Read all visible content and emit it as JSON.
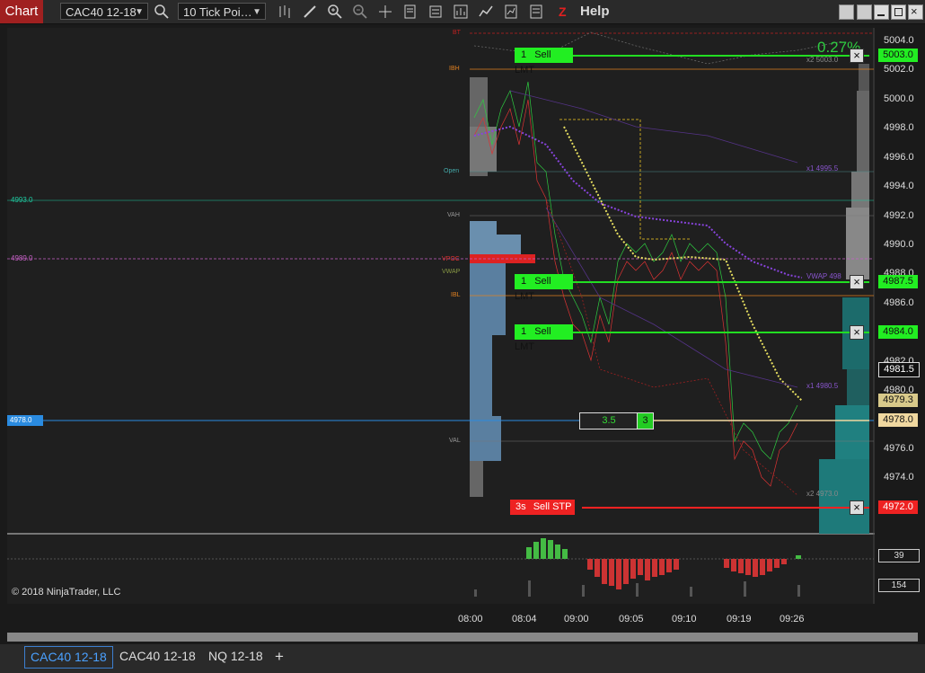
{
  "window": {
    "title": "Chart",
    "help": "Help"
  },
  "toolbar": {
    "instrument": "CAC40 12-18",
    "bar_type": "10 Tick Poi…",
    "icons": [
      "search-icon",
      "bar-type-icon",
      "draw-icon",
      "zoom-in-icon",
      "zoom-out-icon",
      "crosshair-icon",
      "data-box-icon",
      "properties-icon",
      "strategies-icon",
      "indicators-icon",
      "templates-icon",
      "chart-trader-icon",
      "z-order-icon"
    ]
  },
  "chart": {
    "price_axis": [
      "5004.0",
      "5002.0",
      "5000.0",
      "4998.0",
      "4996.0",
      "4994.0",
      "4992.0",
      "4990.0",
      "4988.0",
      "4986.0",
      "4982.0",
      "4980.0",
      "4976.0",
      "4974.0"
    ],
    "time_axis": [
      "08:00",
      "08:04",
      "09:00",
      "09:05",
      "09:10",
      "09:19",
      "09:26"
    ],
    "percent_change": "0.27%",
    "copyright": "© 2018 NinjaTrader, LLC",
    "left_levels": {
      "green_line": "4993.0",
      "pink_line": "4989.0",
      "blue_line": "4978.0"
    },
    "profile_labels": [
      "BT",
      "IBH",
      "Open",
      "VAH",
      "VPOC",
      "VWAP",
      "IBL",
      "VAL"
    ],
    "indicator_labels": {
      "x2_top": "x2 5003.0",
      "x1_upper": "x1 4995.5",
      "vwap": "VWAP 498",
      "x1_lower": "x1 4980.5",
      "x2_bottom": "x2 4973.0"
    },
    "price_flags": {
      "f1": "5003.0",
      "f2": "4987.5",
      "f3": "4984.0",
      "f4": "4981.5",
      "f5": "4979.3",
      "f6": "4978.0",
      "f7": "4972.0"
    },
    "orders": [
      {
        "qty": "1",
        "label": "Sell LMT",
        "price": "5003.0",
        "color": "#22dd22"
      },
      {
        "qty": "1",
        "label": "Sell LMT",
        "price": "4987.5",
        "color": "#22dd22"
      },
      {
        "qty": "1",
        "label": "Sell LMT",
        "price": "4984.0",
        "color": "#22dd22"
      },
      {
        "qty": "3s",
        "label": "Sell STP",
        "price": "4972.0",
        "color": "#ff2222"
      }
    ],
    "position": {
      "avg_price": "3.5",
      "qty": "3"
    },
    "lower_panel": {
      "value1": "39",
      "value2": "154"
    }
  },
  "tabs": [
    "CAC40 12-18",
    "CAC40 12-18",
    "NQ 12-18"
  ],
  "add_tab": "+"
}
